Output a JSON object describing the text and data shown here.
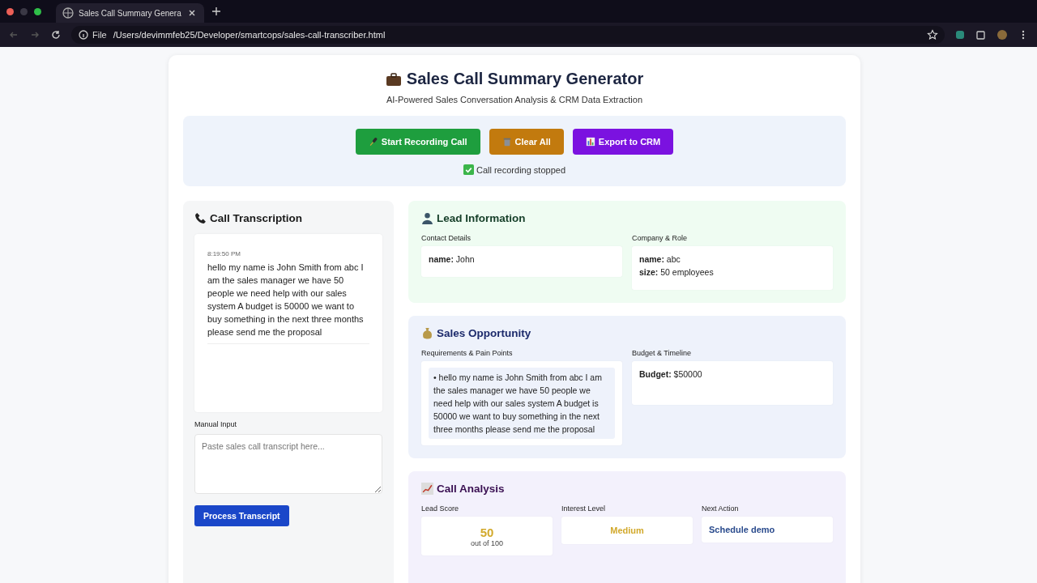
{
  "browser": {
    "tab_title": "Sales Call Summary Genera",
    "address_label": "File",
    "url": "/Users/devimmfeb25/Developer/smartcops/sales-call-transcriber.html"
  },
  "header": {
    "title": "Sales Call Summary Generator",
    "subtitle": "AI-Powered Sales Conversation Analysis & CRM Data Extraction"
  },
  "controls": {
    "buttons": [
      {
        "label": "Start Recording Call",
        "color": "#1e9e3e",
        "kind": "mic"
      },
      {
        "label": "Clear All",
        "color": "#c27a0e",
        "kind": "trash"
      },
      {
        "label": "Export to CRM",
        "color": "#7b12e0",
        "kind": "chart"
      }
    ],
    "status": "Call recording stopped"
  },
  "transcription": {
    "title": "Call Transcription",
    "entries": [
      {
        "time": "8:19:50 PM",
        "text": "hello my name is John Smith from abc I am the sales manager we have 50 people we need help with our sales system A budget is 50000 we want to buy something in the next three months please send me the proposal"
      }
    ],
    "manual_input_label": "Manual Input",
    "manual_input": {
      "placeholder": "Paste sales call transcript here..."
    },
    "process_button": "Process Transcript"
  },
  "lead_information": {
    "title": "Lead Information",
    "fields": [
      {
        "label": "Contact Details",
        "lines": [
          "**name:** John"
        ]
      },
      {
        "label": "Company & Role",
        "lines": [
          "**name:** abc",
          "**size:** 50 employees"
        ]
      }
    ]
  },
  "sales_opportunity": {
    "title": "Sales Opportunity",
    "fields": [
      {
        "label": "Requirements & Pain Points",
        "items": [
          "• hello my name is John Smith from abc I am the sales manager we have 50 people we need help with our sales system A budget is 50000 we want to buy something in the next three months please send me the proposal"
        ]
      },
      {
        "label": "Budget & Timeline",
        "lines": [
          "**Budget:** $50000"
        ]
      }
    ]
  },
  "call_analysis": {
    "title": "Call Analysis",
    "lead_score": {
      "label": "Lead Score",
      "value": "50",
      "caption": "out of 100"
    },
    "interest_level": {
      "label": "Interest Level",
      "value": "Medium"
    },
    "next_action": {
      "label": "Next Action",
      "value": "Schedule demo"
    }
  }
}
